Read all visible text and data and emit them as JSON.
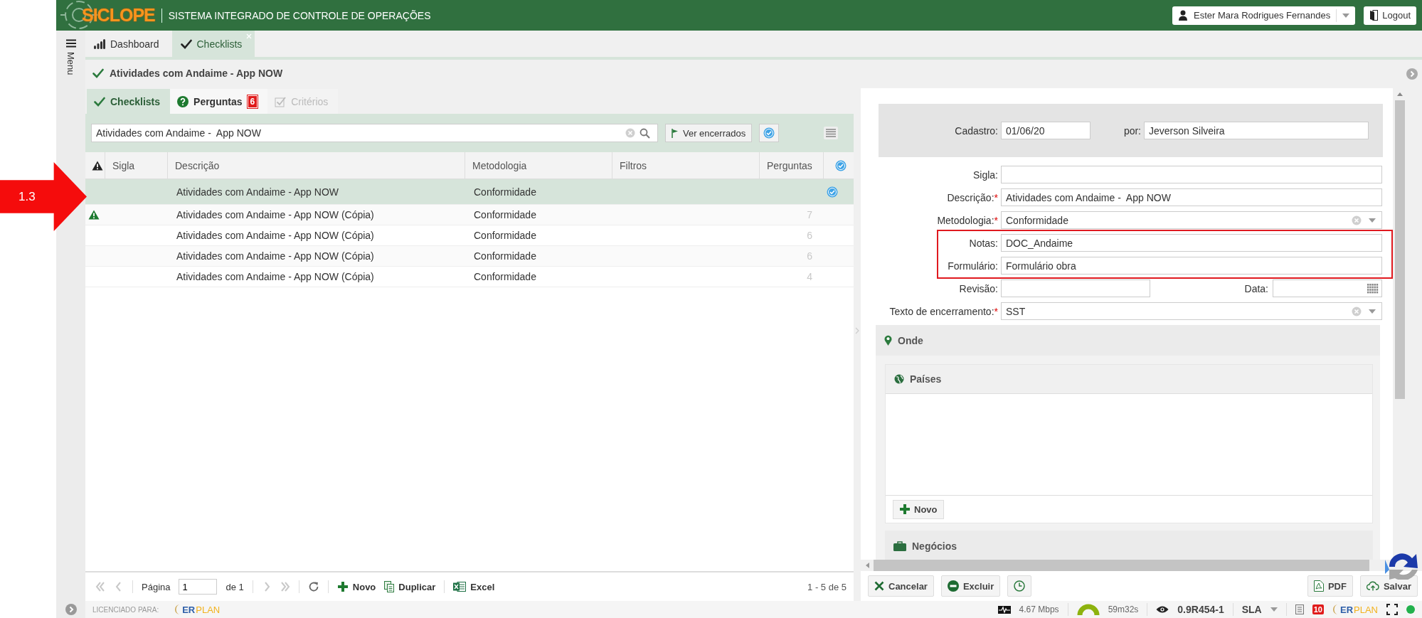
{
  "annotation": {
    "label": "1.3"
  },
  "header": {
    "logo": "SICLOPE",
    "title": "SISTEMA INTEGRADO DE CONTROLE DE OPERAÇÕES",
    "user": "Ester Mara Rodrigues Fernandes",
    "logout": "Logout"
  },
  "sidebar": {
    "label": "Menu"
  },
  "tabs": [
    {
      "label": "Dashboard",
      "kind": "chart",
      "selected": false,
      "closable": false
    },
    {
      "label": "Checklists",
      "kind": "check",
      "selected": true,
      "closable": true
    }
  ],
  "record_title": "Atividades com Andaime - App NOW",
  "subtabs": [
    {
      "label": "Checklists",
      "kind": "check",
      "selected": true,
      "disabled": false
    },
    {
      "label": "Perguntas",
      "kind": "question",
      "badge": "6",
      "selected": false,
      "disabled": false
    },
    {
      "label": "Critérios",
      "kind": "checkbox",
      "selected": false,
      "disabled": true
    }
  ],
  "search": {
    "value": "Atividades com Andaime -  App NOW"
  },
  "toolbar": {
    "closed_button": "Ver encerrados"
  },
  "table": {
    "columns": [
      "Sigla",
      "Descrição",
      "Metodologia",
      "Filtros",
      "Perguntas"
    ],
    "rows": [
      {
        "descricao": "Atividades com Andaime -  App NOW",
        "metodologia": "Conformidade",
        "warning": false,
        "checked": true,
        "selected": true
      },
      {
        "descricao": "Atividades com Andaime -  App NOW (Cópia)",
        "metodologia": "Conformidade",
        "perguntas": "7",
        "warning": true,
        "checked": false,
        "selected": false
      },
      {
        "descricao": "Atividades com Andaime -  App NOW (Cópia)",
        "metodologia": "Conformidade",
        "perguntas": "6",
        "warning": false,
        "checked": false,
        "selected": false
      },
      {
        "descricao": "Atividades com Andaime -  App NOW (Cópia)",
        "metodologia": "Conformidade",
        "perguntas": "6",
        "warning": false,
        "checked": false,
        "selected": false
      },
      {
        "descricao": "Atividades com Andaime -  App NOW (Cópia)",
        "metodologia": "Conformidade",
        "perguntas": "4",
        "warning": false,
        "checked": false,
        "selected": false
      }
    ]
  },
  "pager": {
    "page_label": "Página",
    "page": "1",
    "of_label": "de 1",
    "new": "Novo",
    "duplicate": "Duplicar",
    "excel": "Excel",
    "count": "1 - 5 de 5"
  },
  "form": {
    "required_mark": "*",
    "cadastro": {
      "label": "Cadastro:",
      "value": "01/06/20"
    },
    "por": {
      "label": "por:",
      "value": "Jeverson Silveira"
    },
    "fields": [
      {
        "kind": "text",
        "label": "Sigla:",
        "required": false,
        "highlighted": false
      },
      {
        "kind": "text",
        "label": "Descrição:",
        "value": "Atividades com Andaime -  App NOW",
        "required": true,
        "highlighted": false
      },
      {
        "kind": "select",
        "label": "Metodologia:",
        "value": "Conformidade",
        "required": true,
        "highlighted": false
      },
      {
        "kind": "text",
        "label": "Notas:",
        "value": "DOC_Andaime",
        "required": false,
        "highlighted": true
      },
      {
        "kind": "text",
        "label": "Formulário:",
        "value": "Formulário obra",
        "required": false,
        "highlighted": true
      },
      {
        "kind": "split",
        "label": "Revisão:",
        "second_label": "Data:",
        "required": false,
        "highlighted": false
      },
      {
        "kind": "select",
        "label": "Texto de encerramento:",
        "value": "SST",
        "required": true,
        "highlighted": false
      }
    ]
  },
  "sections": {
    "onde": "Onde",
    "paises": "Países",
    "paises_button": "Novo",
    "negocios": "Negócios"
  },
  "actions": {
    "cancel": "Cancelar",
    "delete": "Excluir",
    "pdf": "PDF",
    "save": "Salvar"
  },
  "footer": {
    "licensed": "LICENCIADO PARA:",
    "brand_parts": [
      "ER",
      "PLAN"
    ]
  },
  "status": {
    "speed": "4.67 Mbps",
    "timer": "59m32s",
    "version": "0.9R454-1",
    "sla": "SLA",
    "notifications": "10",
    "brand_parts": [
      "ER",
      "PLAN"
    ]
  }
}
